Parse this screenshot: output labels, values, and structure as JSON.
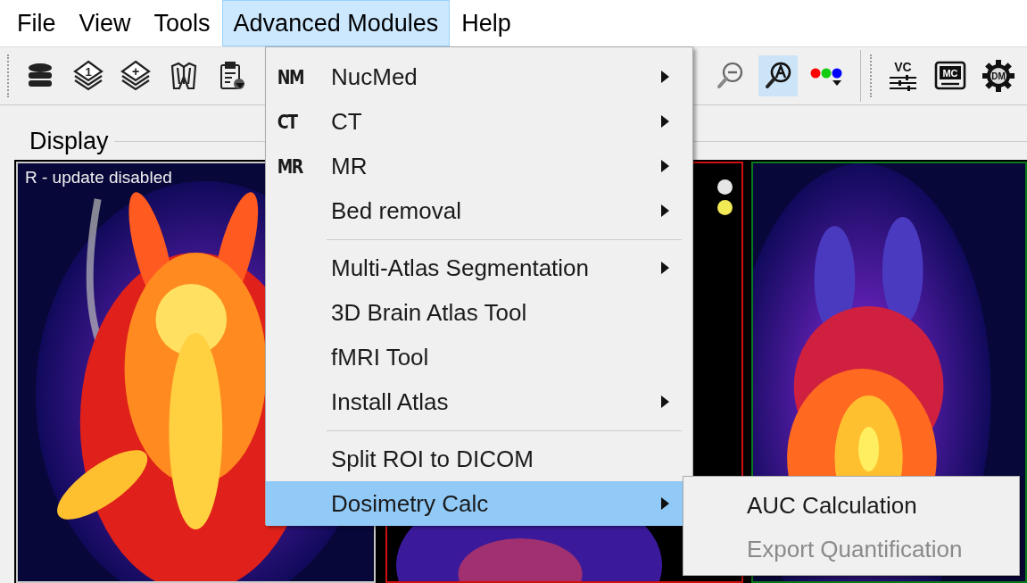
{
  "menubar": [
    {
      "label": "File",
      "selected": false
    },
    {
      "label": "View",
      "selected": false
    },
    {
      "label": "Tools",
      "selected": false
    },
    {
      "label": "Advanced Modules",
      "selected": true
    },
    {
      "label": "Help",
      "selected": false
    }
  ],
  "toolbar": {
    "left_buttons": [
      {
        "selected": false
      },
      {
        "label": "1",
        "selected": false
      },
      {
        "label": "+",
        "selected": false
      },
      {
        "selected": false
      },
      {
        "selected": false
      }
    ],
    "right_buttons": [
      {
        "selected": false
      },
      {
        "selected": true
      },
      {
        "selected": false
      }
    ],
    "module_buttons": [
      {
        "label": "VC"
      },
      {
        "label": "MC"
      },
      {
        "label": "DM"
      }
    ]
  },
  "display": {
    "title": "Display",
    "viewports": [
      {
        "label": "R - update disabled",
        "color": "#c8c8c8"
      },
      {
        "color": "#d01010",
        "markers": [
          {
            "color": "#e6e6e6"
          },
          {
            "color": "#f2ea55"
          }
        ]
      },
      {
        "color": "#0a7a1a"
      }
    ]
  },
  "menu": {
    "items": [
      {
        "kind": "item",
        "tag": "NM",
        "label": "NucMed",
        "submenu": true,
        "selected": false
      },
      {
        "kind": "item",
        "tag": "CT",
        "label": "CT",
        "submenu": true,
        "selected": false
      },
      {
        "kind": "item",
        "tag": "MR",
        "label": "MR",
        "submenu": true,
        "selected": false
      },
      {
        "kind": "item",
        "label": "Bed removal",
        "submenu": true,
        "selected": false
      },
      {
        "kind": "separator"
      },
      {
        "kind": "item",
        "label": "Multi-Atlas Segmentation",
        "submenu": true,
        "selected": false
      },
      {
        "kind": "item",
        "label": "3D Brain Atlas Tool",
        "submenu": false,
        "selected": false
      },
      {
        "kind": "item",
        "label": "fMRI Tool",
        "submenu": false,
        "selected": false
      },
      {
        "kind": "item",
        "label": "Install Atlas",
        "submenu": true,
        "selected": false
      },
      {
        "kind": "separator"
      },
      {
        "kind": "item",
        "label": "Split ROI to DICOM",
        "submenu": false,
        "selected": false
      },
      {
        "kind": "item",
        "label": "Dosimetry Calc",
        "submenu": true,
        "selected": true
      }
    ],
    "submenu": [
      {
        "label": "AUC Calculation",
        "disabled": false
      },
      {
        "label": "Export Quantification",
        "disabled": true
      }
    ]
  }
}
